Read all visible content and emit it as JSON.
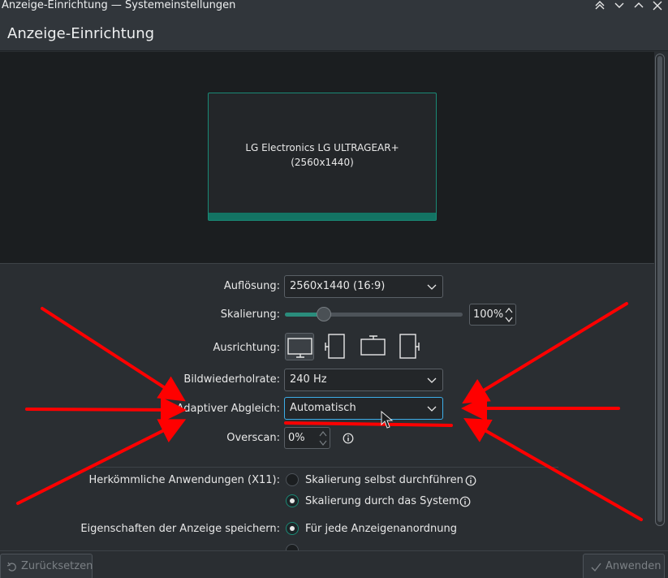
{
  "window": {
    "title": "Anzeige-Einrichtung — Systemeinstellungen"
  },
  "header": {
    "page_title": "Anzeige-Einrichtung"
  },
  "preview": {
    "monitor_name": "LG Electronics LG ULTRAGEAR+",
    "monitor_resolution": "(2560x1440)"
  },
  "settings": {
    "resolution_label": "Auflösung:",
    "resolution_value": "2560x1440 (16:9)",
    "scale_label": "Skalierung:",
    "scale_value": "100%",
    "scale_level_percent": 100,
    "orientation_label": "Ausrichtung:",
    "refresh_label": "Bildwiederholrate:",
    "refresh_value": "240 Hz",
    "adaptive_label": "Adaptiver Abgleich:",
    "adaptive_value": "Automatisch",
    "overscan_label": "Overscan:",
    "overscan_value": "0%"
  },
  "legacy": {
    "label": "Herkömmliche Anwendungen (X11):",
    "option1": "Skalierung selbst durchführen",
    "option2": "Skalierung durch das System",
    "selected": 2
  },
  "save": {
    "label": "Eigenschaften der Anzeige speichern:",
    "option1": "Für jede Anzeigenanordnung",
    "selected": 1
  },
  "footer": {
    "reset_label": "Zurücksetzen",
    "apply_label": "Anwenden"
  },
  "colors": {
    "accent": "#1a8a76",
    "annotation_arrows": "#ff0000"
  }
}
